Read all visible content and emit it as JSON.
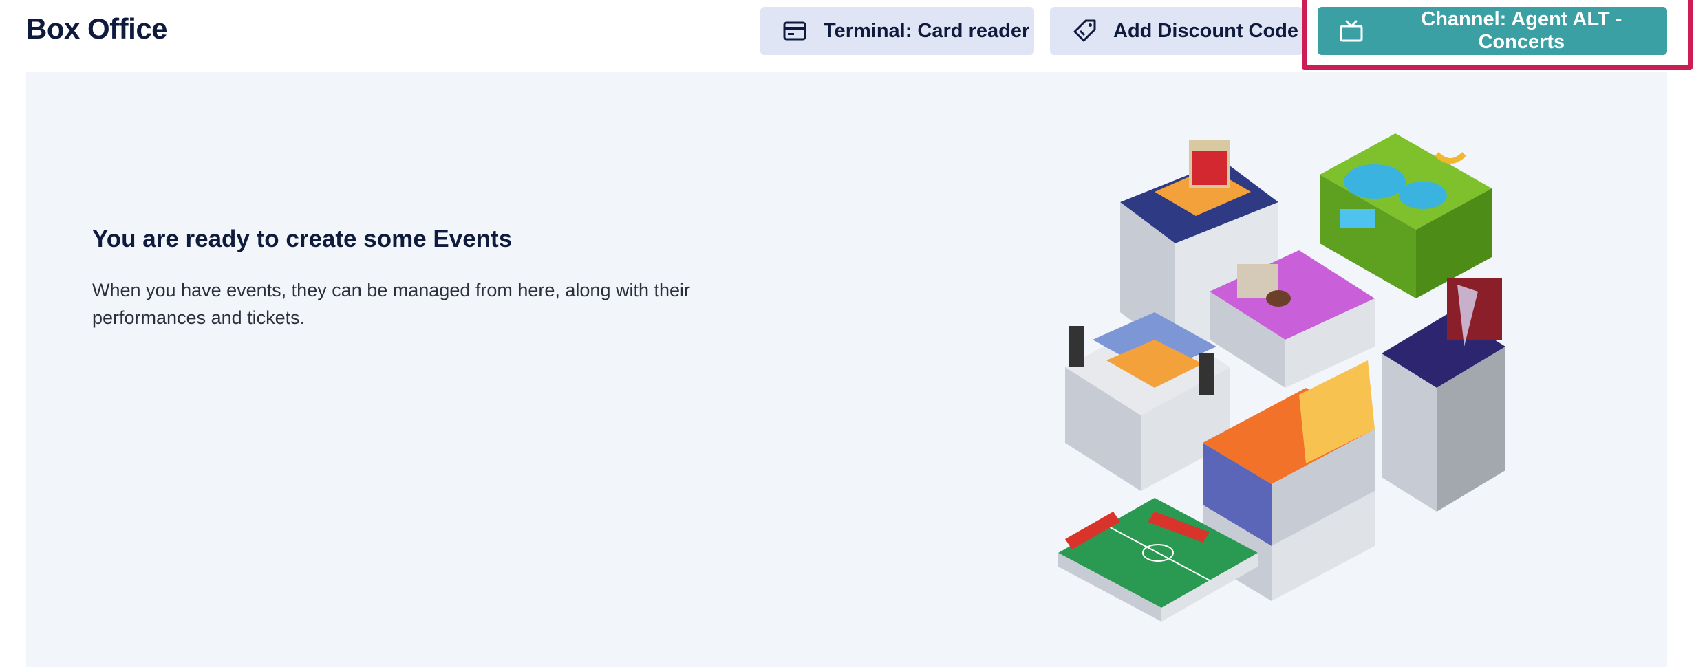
{
  "header": {
    "title": "Box Office",
    "terminal_button": {
      "label": "Terminal: Card reader",
      "icon": "credit-card-icon"
    },
    "discount_button": {
      "label": "Add Discount Code",
      "icon": "tag-icon"
    },
    "channel_button": {
      "label": "Channel: Agent ALT - Concerts",
      "icon": "tv-icon"
    }
  },
  "empty_state": {
    "heading": "You are ready to create some Events",
    "description": "When you have events, they can be managed from here, along with their performances and tickets.",
    "illustration": "isometric-event-venues"
  },
  "colors": {
    "primary": "#3aa0a4",
    "secondary_button": "#dfe5f5",
    "panel_background": "#f2f5fa",
    "highlight": "#cc1e55",
    "text_dark": "#0f1b3d"
  }
}
